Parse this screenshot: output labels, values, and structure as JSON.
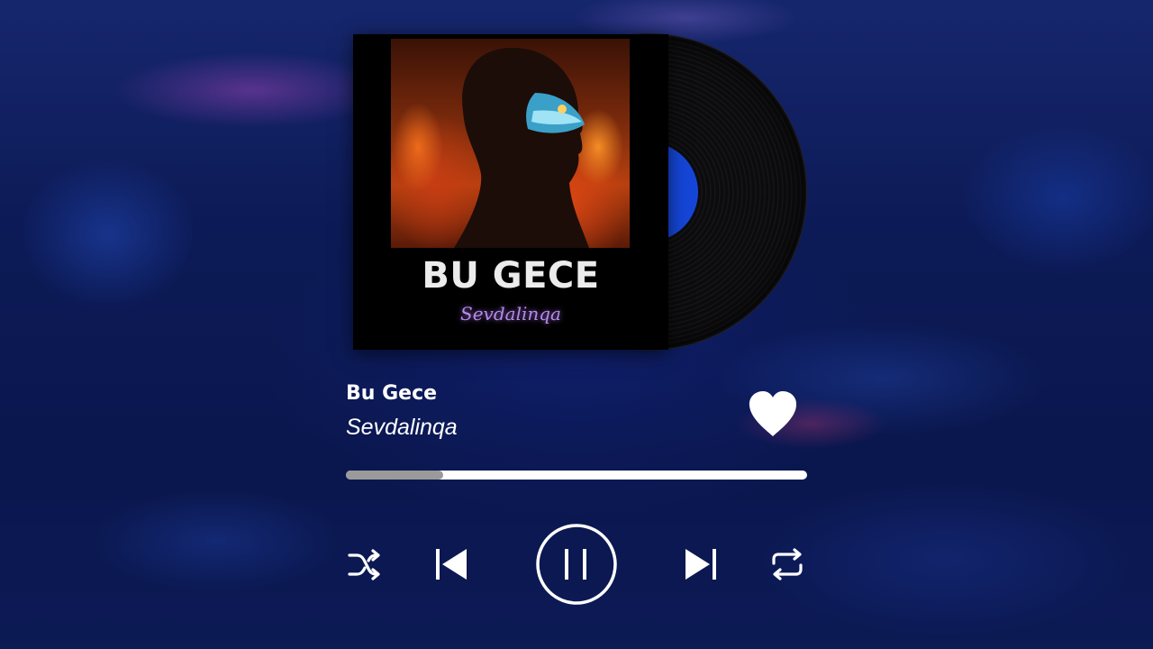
{
  "album": {
    "cover_title": "BU GECE",
    "cover_artist": "Sevdalinqa",
    "vinyl_label_color": "#1546d8"
  },
  "track": {
    "title": "Bu Gece",
    "artist": "Sevdalinqa",
    "liked": true
  },
  "playback": {
    "progress_fraction": 0.21,
    "state": "playing"
  },
  "controls": {
    "shuffle_icon": "shuffle-icon",
    "previous_icon": "skip-previous-icon",
    "pause_icon": "pause-icon",
    "next_icon": "skip-next-icon",
    "repeat_icon": "repeat-icon",
    "like_icon": "heart-icon"
  },
  "colors": {
    "foreground": "#ffffff",
    "progress_track": "#ffffff",
    "progress_fill": "#9a9a9a",
    "artist_script": "#b58be8"
  }
}
